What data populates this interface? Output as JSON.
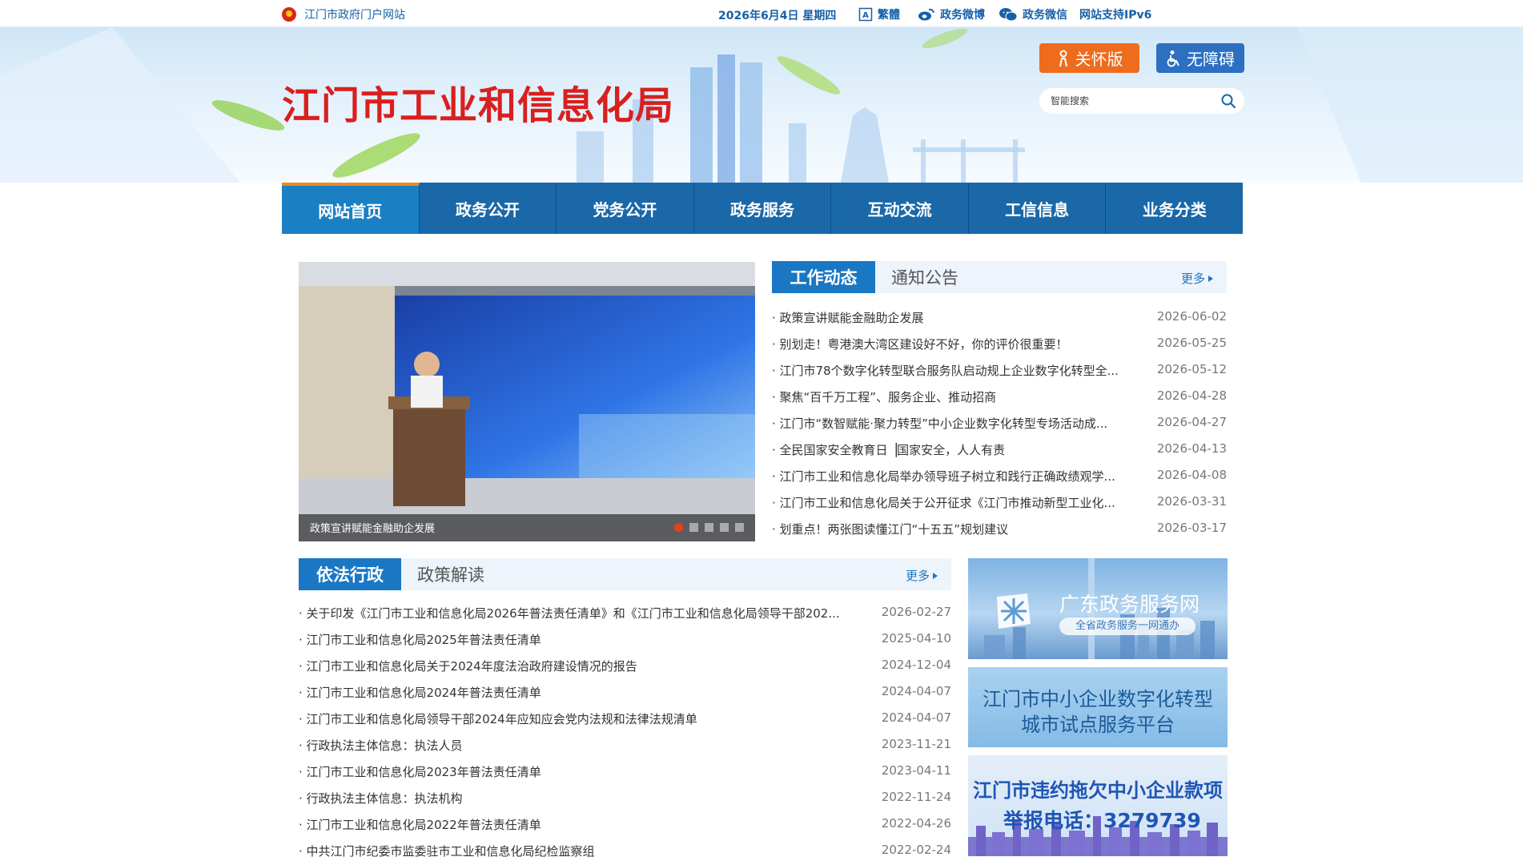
{
  "topbar": {
    "portal_label": "江门市政府门户网站",
    "date": "2026年6月4日 星期四",
    "traditional": "繁體",
    "weibo": "政务微博",
    "wechat": "政务微信",
    "ipv6": "网站支持IPv6"
  },
  "header": {
    "site_title": "江门市工业和信息化局",
    "care_label": "关怀版",
    "accessibility_label": "无障碍",
    "search_placeholder": "智能搜索"
  },
  "nav": {
    "items": [
      "网站首页",
      "政务公开",
      "党务公开",
      "政务服务",
      "互动交流",
      "工信信息",
      "业务分类"
    ],
    "active_index": 0
  },
  "slideshow": {
    "caption": "政策宣讲赋能金融助企发展",
    "dots": 5,
    "active_dot": 0
  },
  "news_panel": {
    "tab_active": "工作动态",
    "tab_inactive": "通知公告",
    "more": "更多",
    "items": [
      {
        "title": "政策宣讲赋能金融助企发展",
        "date": "2026-06-02"
      },
      {
        "title": "别划走！粤港澳大湾区建设好不好，你的评价很重要！",
        "date": "2026-05-25"
      },
      {
        "title": "江门市78个数字化转型联合服务队启动规上企业数字化转型全...",
        "date": "2026-05-12"
      },
      {
        "title": "聚焦“百千万工程”、服务企业、推动招商",
        "date": "2026-04-28"
      },
      {
        "title": "江门市“数智赋能·聚力转型”中小企业数字化转型专场活动成...",
        "date": "2026-04-27"
      },
      {
        "title": "全民国家安全教育日▕国家安全，人人有责",
        "date": "2026-04-13"
      },
      {
        "title": "江门市工业和信息化局举办领导班子树立和践行正确政绩观学...",
        "date": "2026-04-08"
      },
      {
        "title": "江门市工业和信息化局关于公开征求《江门市推动新型工业化...",
        "date": "2026-03-31"
      },
      {
        "title": "划重点！两张图读懂江门“十五五”规划建议",
        "date": "2026-03-17"
      }
    ]
  },
  "law_panel": {
    "tab_active": "依法行政",
    "tab_inactive": "政策解读",
    "more": "更多",
    "items": [
      {
        "title": "关于印发《江门市工业和信息化局2026年普法责任清单》和《江门市工业和信息化局领导干部202...",
        "date": "2026-02-27"
      },
      {
        "title": "江门市工业和信息化局2025年普法责任清单",
        "date": "2025-04-10"
      },
      {
        "title": "江门市工业和信息化局关于2024年度法治政府建设情况的报告",
        "date": "2024-12-04"
      },
      {
        "title": "江门市工业和信息化局2024年普法责任清单",
        "date": "2024-04-07"
      },
      {
        "title": "江门市工业和信息化局领导干部2024年应知应会党内法规和法律法规清单",
        "date": "2024-04-07"
      },
      {
        "title": "行政执法主体信息：执法人员",
        "date": "2023-11-21"
      },
      {
        "title": "江门市工业和信息化局2023年普法责任清单",
        "date": "2023-04-11"
      },
      {
        "title": "行政执法主体信息：执法机构",
        "date": "2022-11-24"
      },
      {
        "title": "江门市工业和信息化局2022年普法责任清单",
        "date": "2022-04-26"
      },
      {
        "title": "中共江门市纪委市监委驻市工业和信息化局纪检监察组",
        "date": "2022-02-24"
      }
    ]
  },
  "promos": {
    "gd_service_title": "广东政务服务网",
    "gd_service_sub": "全省政务服务一网通办",
    "sme_line1": "江门市中小企业数字化转型",
    "sme_line2": "城市试点服务平台",
    "arrears_line1": "江门市违约拖欠中小企业款项",
    "arrears_line2": "举报电话：3279739"
  },
  "colors": {
    "brand_blue": "#1a68a8",
    "title_red": "#d8201f",
    "care_orange": "#ef6b1e",
    "accent_orange": "#f08a1c"
  }
}
